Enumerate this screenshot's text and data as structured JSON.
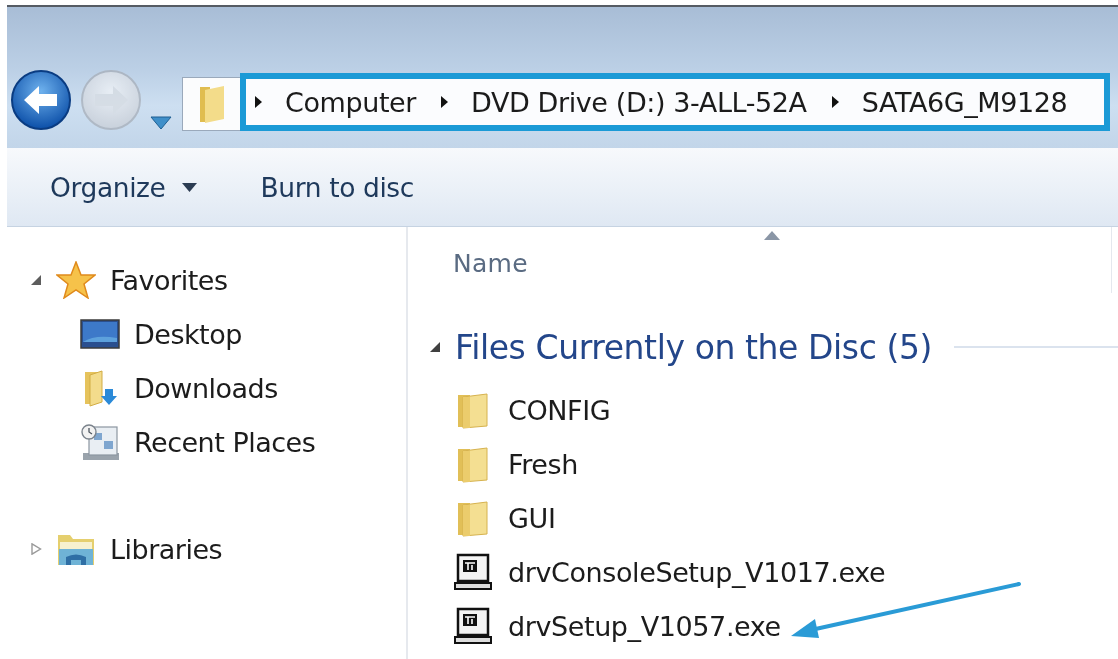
{
  "navigation": {
    "back": {
      "disabled": false
    },
    "forward": {
      "disabled": true
    }
  },
  "address_bar": {
    "highlighted": true,
    "segments": [
      "Computer",
      "DVD Drive (D:) 3-ALL-52A",
      "SATA6G_M9128"
    ]
  },
  "toolbar": {
    "buttons": [
      {
        "label": "Organize",
        "kind": "menu"
      },
      {
        "label": "Burn to disc",
        "kind": "plain"
      }
    ]
  },
  "nav_pane": {
    "items": [
      {
        "label": "Favorites",
        "kind": "favorites",
        "expanded": true,
        "children": [
          {
            "label": "Desktop",
            "kind": "desktop"
          },
          {
            "label": "Downloads",
            "kind": "downloads"
          },
          {
            "label": "Recent Places",
            "kind": "recent"
          }
        ]
      },
      {
        "label": "Libraries",
        "kind": "libraries",
        "expanded": false
      }
    ]
  },
  "file_list": {
    "columns": [
      {
        "label": "Name",
        "sorted": true
      }
    ],
    "groups": [
      {
        "title": "Files Currently on the Disc (5)",
        "expanded": true,
        "items": [
          {
            "name": "CONFIG",
            "kind": "folder",
            "arrow": false
          },
          {
            "name": "Fresh",
            "kind": "folder",
            "arrow": false
          },
          {
            "name": "GUI",
            "kind": "folder",
            "arrow": false
          },
          {
            "name": "drvConsoleSetup_V1017.exe",
            "kind": "exe",
            "arrow": false
          },
          {
            "name": "drvSetup_V1057.exe",
            "kind": "exe",
            "arrow": true
          }
        ]
      }
    ]
  }
}
